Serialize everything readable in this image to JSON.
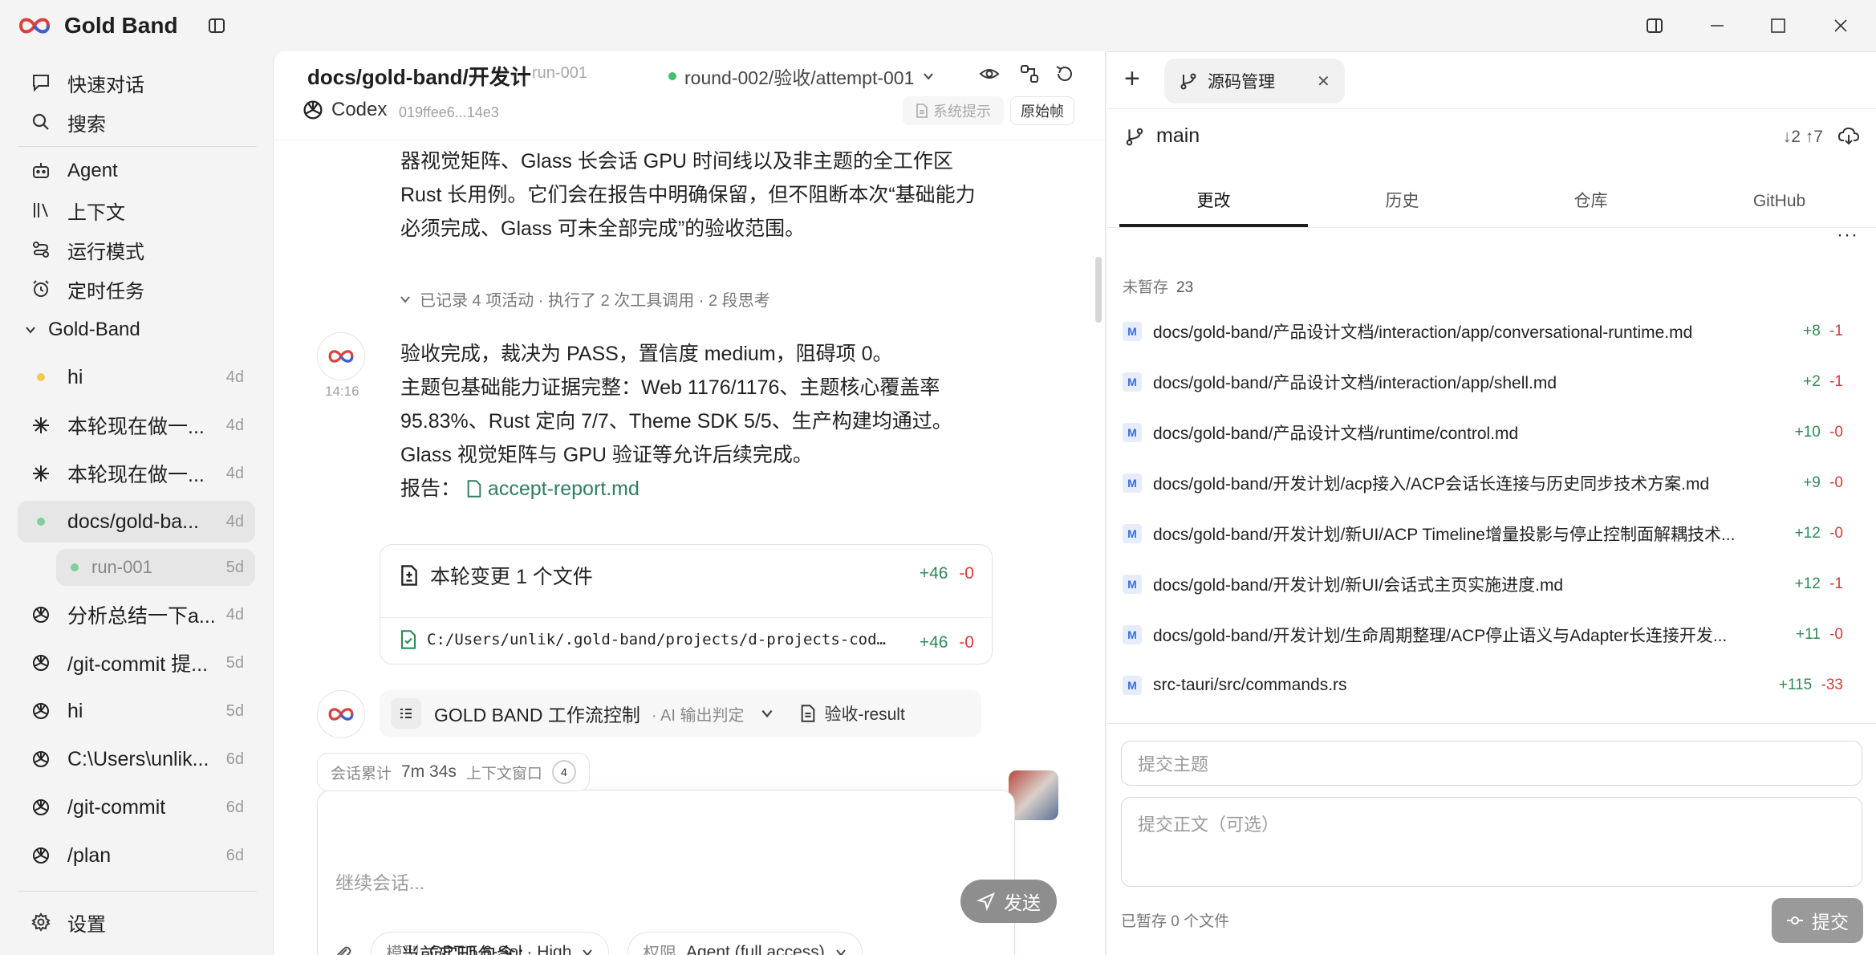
{
  "app": {
    "title": "Gold Band"
  },
  "colors": {
    "accent": "#2f7d63",
    "added": "#2e8b57",
    "removed": "#d23c3c",
    "modified_badge": "#3a6fd8",
    "status_dot_green": "#7fcf9f",
    "status_dot_yellow": "#f2c94c"
  },
  "sidebar": {
    "top": [
      {
        "label": "快速对话",
        "icon": "chat-bubble-icon"
      },
      {
        "label": "搜索",
        "icon": "search-icon"
      }
    ],
    "nav": [
      {
        "label": "Agent",
        "icon": "robot-icon"
      },
      {
        "label": "上下文",
        "icon": "library-icon"
      },
      {
        "label": "运行模式",
        "icon": "workflow-icon"
      },
      {
        "label": "定时任务",
        "icon": "alarm-clock-icon"
      }
    ],
    "group": {
      "label": "Gold-Band",
      "icon": "chevron-down-icon"
    },
    "chats": [
      {
        "label": "hi",
        "age": "4d",
        "icon": "status-dot-yellow"
      },
      {
        "label": "本轮现在做一...",
        "age": "4d",
        "icon": "spark-icon"
      },
      {
        "label": "本轮现在做一...",
        "age": "4d",
        "icon": "spark-icon"
      },
      {
        "label": "docs/gold-ba...",
        "age": "4d",
        "icon": "status-dot-green"
      },
      {
        "label": "run-001",
        "age": "5d",
        "icon": "status-dot-green"
      },
      {
        "label": "分析总结一下a...",
        "age": "4d",
        "icon": "openai-icon"
      },
      {
        "label": "/git-commit 提...",
        "age": "5d",
        "icon": "openai-icon"
      },
      {
        "label": "hi",
        "age": "5d",
        "icon": "openai-icon"
      },
      {
        "label": "C:\\Users\\unlik...",
        "age": "6d",
        "icon": "openai-icon"
      },
      {
        "label": "/git-commit",
        "age": "6d",
        "icon": "openai-icon"
      },
      {
        "label": "/plan",
        "age": "6d",
        "icon": "openai-icon"
      }
    ],
    "settings": {
      "label": "设置",
      "icon": "gear-icon"
    }
  },
  "center": {
    "path": "docs/gold-band/开发计",
    "run": "run-001",
    "round": "round-002/验收/attempt-001",
    "agent": "Codex",
    "hash": "019ffee6...14e3",
    "system_prompt_label": "系统提示",
    "raw_frame_label": "原始帧",
    "prev_message_lines": [
      "器视觉矩阵、Glass 长会话 GPU 时间线以及非主题的全工作区",
      "Rust 长用例。它们会在报告中明确保留，但不阻断本次“基础能力",
      "必须完成、Glass 可未全部完成”的验收范围。"
    ],
    "activity_summary": "已记录 4 项活动 · 执行了 2 次工具调用 · 2 段思考",
    "message": {
      "time": "14:16",
      "lines": [
        "验收完成，裁决为 PASS，置信度 medium，阻碍项 0。",
        "主题包基础能力证据完整：Web 1176/1176、主题核心覆盖率",
        "95.83%、Rust 定向 7/7、Theme SDK 5/5、生产构建均通过。",
        "Glass 视觉矩阵与 GPU 验证等允许后续完成。"
      ],
      "report_label": "报告：",
      "report_link": "accept-report.md"
    },
    "change_card": {
      "title": "本轮变更 1 个文件",
      "added": "+46",
      "removed": "-0",
      "file_path": "C:/Users/unlik/.gold-band/projects/d-projects-cod…",
      "file_added": "+46",
      "file_removed": "-0"
    },
    "workflow": {
      "title": "GOLD BAND 工作流控制",
      "subtitle": "· AI 输出判定",
      "result": "验收-result"
    },
    "composer": {
      "session_total_label": "会话累计",
      "session_total_value": "7m 34s",
      "context_window_label": "上下文窗口",
      "context_window_value": "4",
      "placeholder": "继续会话...",
      "model_label": "模型",
      "model_value": "GPT-5.6-Sol · High",
      "permission_label": "权限",
      "permission_value": "Agent (full access)",
      "send_label": "发送"
    },
    "bottom_partial_text": "当前实现包含："
  },
  "right": {
    "tab_title": "源码管理",
    "branch": "main",
    "sync": "↓2 ↑7",
    "tabs": [
      "更改",
      "历史",
      "仓库",
      "GitHub"
    ],
    "active_tab": 0,
    "unstaged_label": "未暂存",
    "unstaged_count": "23",
    "files": [
      {
        "status": "M",
        "path": "docs/gold-band/产品设计文档/interaction/app/conversational-runtime.md",
        "added": "+8",
        "removed": "-1"
      },
      {
        "status": "M",
        "path": "docs/gold-band/产品设计文档/interaction/app/shell.md",
        "added": "+2",
        "removed": "-1"
      },
      {
        "status": "M",
        "path": "docs/gold-band/产品设计文档/runtime/control.md",
        "added": "+10",
        "removed": "-0"
      },
      {
        "status": "M",
        "path": "docs/gold-band/开发计划/acp接入/ACP会话长连接与历史同步技术方案.md",
        "added": "+9",
        "removed": "-0"
      },
      {
        "status": "M",
        "path": "docs/gold-band/开发计划/新UI/ACP Timeline增量投影与停止控制面解耦技术...",
        "added": "+12",
        "removed": "-0"
      },
      {
        "status": "M",
        "path": "docs/gold-band/开发计划/新UI/会话式主页实施进度.md",
        "added": "+12",
        "removed": "-1"
      },
      {
        "status": "M",
        "path": "docs/gold-band/开发计划/生命周期整理/ACP停止语义与Adapter长连接开发...",
        "added": "+11",
        "removed": "-0"
      },
      {
        "status": "M",
        "path": "src-tauri/src/commands.rs",
        "added": "+115",
        "removed": "-33"
      }
    ],
    "commit_subject_placeholder": "提交主题",
    "commit_body_placeholder": "提交正文（可选）",
    "staged_label": "已暂存 0 个文件",
    "commit_button": "提交"
  }
}
